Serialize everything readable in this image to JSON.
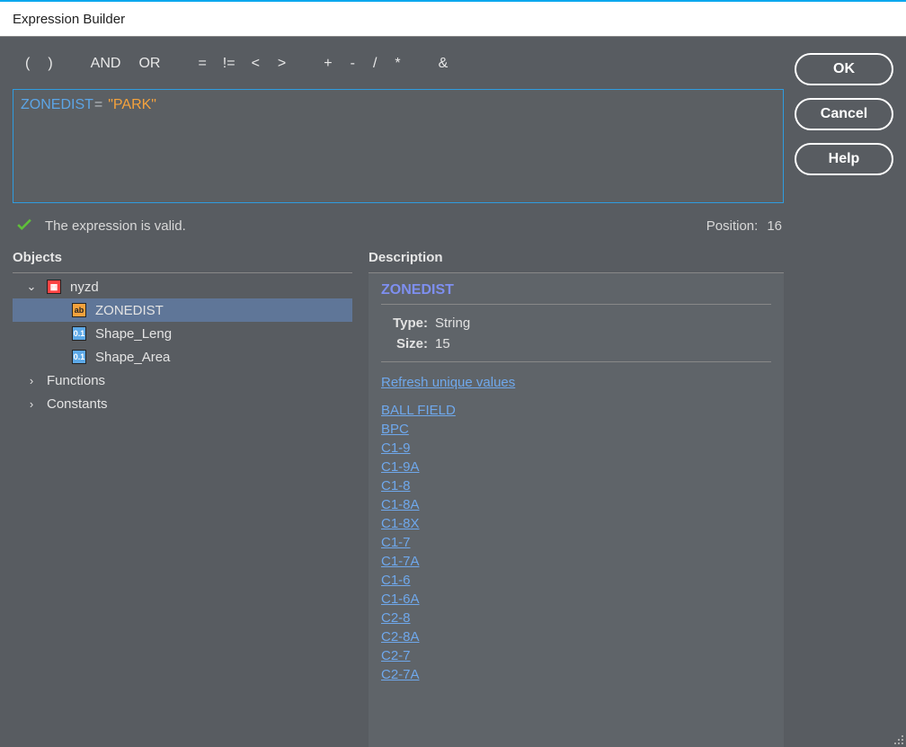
{
  "title": "Expression Builder",
  "operators": [
    "(",
    ")",
    "AND",
    "OR",
    "=",
    "!=",
    "<",
    ">",
    "+",
    "-",
    "/",
    "*",
    "&"
  ],
  "expression": {
    "field": "ZONEDIST",
    "op": "=",
    "value": "\"PARK\""
  },
  "status": {
    "text": "The expression is valid.",
    "position_label": "Position:",
    "position_value": "16"
  },
  "buttons": {
    "ok": "OK",
    "cancel": "Cancel",
    "help": "Help"
  },
  "objects_header": "Objects",
  "description_header": "Description",
  "tree": {
    "root_label": "nyzd",
    "fields": [
      "ZONEDIST",
      "Shape_Leng",
      "Shape_Area"
    ],
    "functions_label": "Functions",
    "constants_label": "Constants"
  },
  "desc": {
    "title": "ZONEDIST",
    "type_label": "Type:",
    "type_value": "String",
    "size_label": "Size:",
    "size_value": "15",
    "refresh": "Refresh unique values",
    "values": [
      "BALL FIELD",
      "BPC",
      "C1-9",
      "C1-9A",
      "C1-8",
      "C1-8A",
      "C1-8X",
      "C1-7",
      "C1-7A",
      "C1-6",
      "C1-6A",
      "C2-8",
      "C2-8A",
      "C2-7",
      "C2-7A"
    ]
  }
}
